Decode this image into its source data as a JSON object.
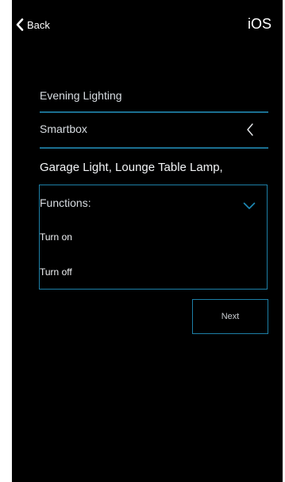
{
  "nav": {
    "back_label": "Back",
    "back_icon": "chevron-left-icon",
    "platform": "iOS"
  },
  "form": {
    "scene_name": "Evening Lighting",
    "smartbox": "Smartbox",
    "smartbox_icon": "chevron-left-icon",
    "devices": "Garage Light, Lounge Table Lamp,",
    "functions": {
      "label": "Functions:",
      "icon": "chevron-down-icon",
      "options": [
        "Turn on",
        "Turn off"
      ]
    },
    "next_label": "Next"
  },
  "colors": {
    "background": "#000000",
    "accent": "#1d7fa6",
    "text": "#d8dde2"
  }
}
